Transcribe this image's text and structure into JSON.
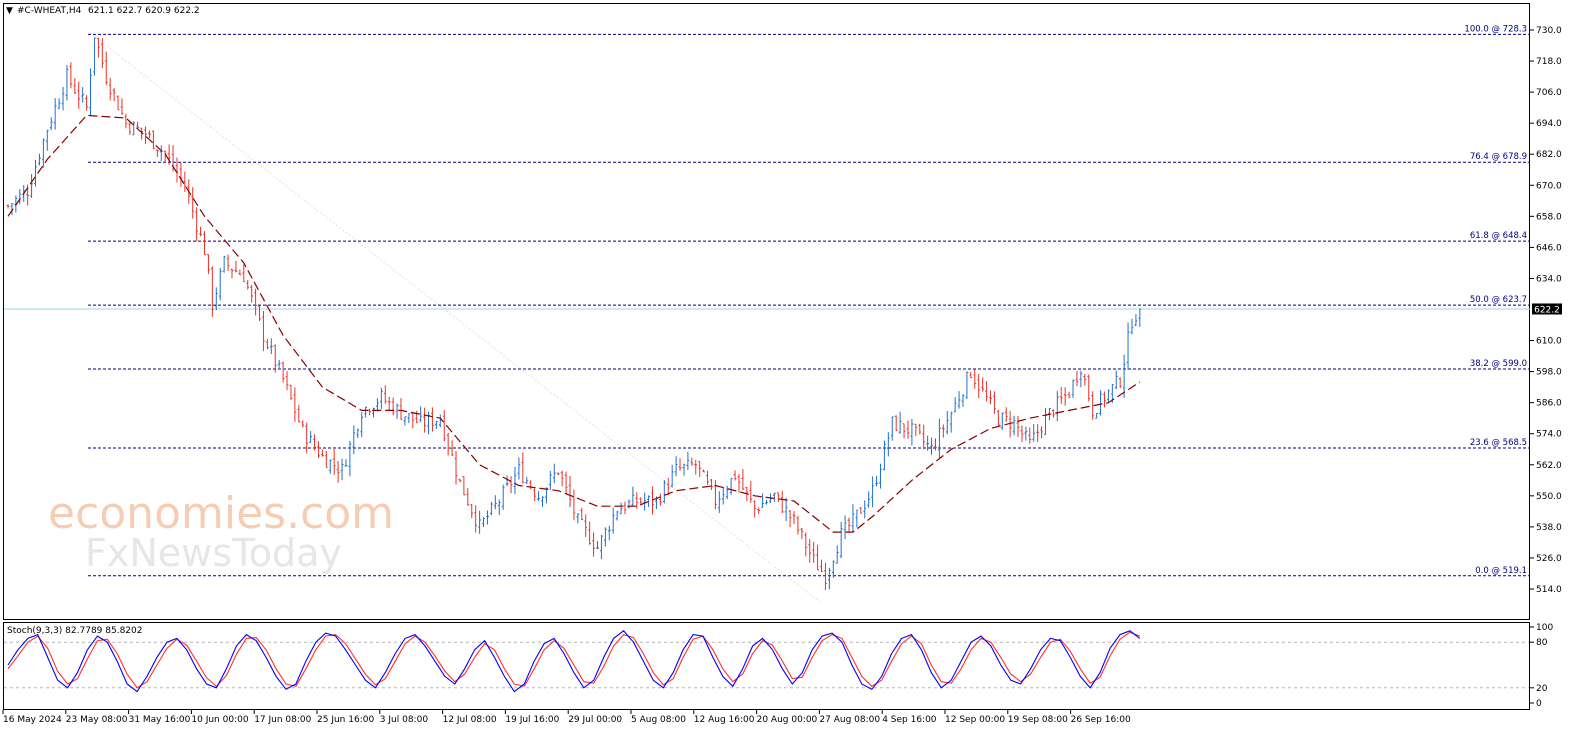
{
  "header": {
    "title_prefix": "▼",
    "title": "#C-WHEAT,H4",
    "ohlc": "621.1 622.7 620.9 622.2"
  },
  "watermark": {
    "line1": "economies.com",
    "line2": "FxNewsToday"
  },
  "colors": {
    "up": "#1f6fd1",
    "down": "#e8322a",
    "ma": "#8b0000",
    "fib": "#00007f",
    "price_line": "#9fd4ea",
    "stoch_main": "#0000ff",
    "stoch_signal": "#ff3030"
  },
  "price_axis": {
    "ticks": [
      "730.0",
      "718.0",
      "706.0",
      "694.0",
      "682.0",
      "670.0",
      "658.0",
      "646.0",
      "634.0",
      "622.2",
      "610.0",
      "598.0",
      "586.0",
      "574.0",
      "562.0",
      "550.0",
      "538.0",
      "526.0",
      "514.0"
    ],
    "current": "622.2"
  },
  "fib_levels": [
    {
      "label": "100.0 @ 728.3",
      "value": 728.3
    },
    {
      "label": "76.4 @ 678.9",
      "value": 678.9
    },
    {
      "label": "61.8 @ 648.4",
      "value": 648.4
    },
    {
      "label": "50.0 @ 623.7",
      "value": 623.7
    },
    {
      "label": "38.2 @ 599.0",
      "value": 599.0
    },
    {
      "label": "23.6 @ 568.5",
      "value": 568.5
    },
    {
      "label": "0.0 @ 519.1",
      "value": 519.1
    }
  ],
  "stoch": {
    "label": "Stoch(9,3,3) 82.7789 85.8202",
    "ticks": [
      "100",
      "80",
      "20",
      "0"
    ],
    "main": 82.78,
    "signal": 85.82
  },
  "time_axis": [
    "16 May 2024",
    "23 May 08:00",
    "31 May 16:00",
    "10 Jun 00:00",
    "17 Jun 08:00",
    "25 Jun 16:00",
    "3 Jul 08:00",
    "12 Jul 08:00",
    "19 Jul 16:00",
    "29 Jul 00:00",
    "5 Aug 08:00",
    "12 Aug 16:00",
    "20 Aug 00:00",
    "27 Aug 08:00",
    "4 Sep 16:00",
    "12 Sep 00:00",
    "19 Sep 08:00",
    "26 Sep 16:00"
  ],
  "chart_data": {
    "type": "candlestick",
    "symbol": "#C-WHEAT",
    "timeframe": "H4",
    "ylim": [
      514,
      732
    ],
    "close_path": [
      {
        "bar": 0,
        "close": 662
      },
      {
        "bar": 5,
        "close": 668
      },
      {
        "bar": 10,
        "close": 692
      },
      {
        "bar": 15,
        "close": 712
      },
      {
        "bar": 20,
        "close": 700
      },
      {
        "bar": 22,
        "close": 728.3
      },
      {
        "bar": 25,
        "close": 712
      },
      {
        "bar": 30,
        "close": 694
      },
      {
        "bar": 35,
        "close": 690
      },
      {
        "bar": 40,
        "close": 682
      },
      {
        "bar": 45,
        "close": 670
      },
      {
        "bar": 50,
        "close": 645
      },
      {
        "bar": 52,
        "close": 624
      },
      {
        "bar": 55,
        "close": 640
      },
      {
        "bar": 60,
        "close": 635
      },
      {
        "bar": 65,
        "close": 612
      },
      {
        "bar": 70,
        "close": 595
      },
      {
        "bar": 75,
        "close": 575
      },
      {
        "bar": 80,
        "close": 565
      },
      {
        "bar": 85,
        "close": 560
      },
      {
        "bar": 90,
        "close": 583
      },
      {
        "bar": 95,
        "close": 588
      },
      {
        "bar": 100,
        "close": 582
      },
      {
        "bar": 105,
        "close": 578
      },
      {
        "bar": 110,
        "close": 580
      },
      {
        "bar": 115,
        "close": 555
      },
      {
        "bar": 120,
        "close": 538
      },
      {
        "bar": 125,
        "close": 548
      },
      {
        "bar": 130,
        "close": 560
      },
      {
        "bar": 135,
        "close": 550
      },
      {
        "bar": 140,
        "close": 560
      },
      {
        "bar": 145,
        "close": 540
      },
      {
        "bar": 150,
        "close": 530
      },
      {
        "bar": 155,
        "close": 545
      },
      {
        "bar": 160,
        "close": 548
      },
      {
        "bar": 165,
        "close": 548
      },
      {
        "bar": 170,
        "close": 560
      },
      {
        "bar": 175,
        "close": 562
      },
      {
        "bar": 180,
        "close": 548
      },
      {
        "bar": 185,
        "close": 558
      },
      {
        "bar": 190,
        "close": 545
      },
      {
        "bar": 195,
        "close": 550
      },
      {
        "bar": 200,
        "close": 540
      },
      {
        "bar": 205,
        "close": 525
      },
      {
        "bar": 208,
        "close": 519.1
      },
      {
        "bar": 212,
        "close": 535
      },
      {
        "bar": 215,
        "close": 540
      },
      {
        "bar": 220,
        "close": 552
      },
      {
        "bar": 225,
        "close": 578
      },
      {
        "bar": 230,
        "close": 575
      },
      {
        "bar": 235,
        "close": 568
      },
      {
        "bar": 240,
        "close": 582
      },
      {
        "bar": 245,
        "close": 598
      },
      {
        "bar": 248,
        "close": 590
      },
      {
        "bar": 252,
        "close": 580
      },
      {
        "bar": 256,
        "close": 578
      },
      {
        "bar": 260,
        "close": 570
      },
      {
        "bar": 265,
        "close": 582
      },
      {
        "bar": 270,
        "close": 590
      },
      {
        "bar": 273,
        "close": 600
      },
      {
        "bar": 276,
        "close": 583
      },
      {
        "bar": 280,
        "close": 590
      },
      {
        "bar": 283,
        "close": 595
      },
      {
        "bar": 286,
        "close": 618
      },
      {
        "bar": 288,
        "close": 622.2
      }
    ],
    "moving_average": [
      {
        "bar": 0,
        "value": 658
      },
      {
        "bar": 10,
        "value": 680
      },
      {
        "bar": 20,
        "value": 697
      },
      {
        "bar": 30,
        "value": 696
      },
      {
        "bar": 40,
        "value": 682
      },
      {
        "bar": 50,
        "value": 658
      },
      {
        "bar": 60,
        "value": 640
      },
      {
        "bar": 70,
        "value": 612
      },
      {
        "bar": 80,
        "value": 592
      },
      {
        "bar": 90,
        "value": 583
      },
      {
        "bar": 100,
        "value": 583
      },
      {
        "bar": 110,
        "value": 580
      },
      {
        "bar": 120,
        "value": 562
      },
      {
        "bar": 130,
        "value": 554
      },
      {
        "bar": 140,
        "value": 552
      },
      {
        "bar": 150,
        "value": 546
      },
      {
        "bar": 160,
        "value": 546
      },
      {
        "bar": 170,
        "value": 552
      },
      {
        "bar": 180,
        "value": 554
      },
      {
        "bar": 190,
        "value": 550
      },
      {
        "bar": 200,
        "value": 548
      },
      {
        "bar": 210,
        "value": 536
      },
      {
        "bar": 215,
        "value": 536
      },
      {
        "bar": 220,
        "value": 542
      },
      {
        "bar": 230,
        "value": 556
      },
      {
        "bar": 240,
        "value": 568
      },
      {
        "bar": 250,
        "value": 576
      },
      {
        "bar": 260,
        "value": 580
      },
      {
        "bar": 270,
        "value": 583
      },
      {
        "bar": 280,
        "value": 586
      },
      {
        "bar": 288,
        "value": 594
      }
    ],
    "stochastic": {
      "main": [
        50,
        70,
        85,
        90,
        60,
        30,
        20,
        40,
        70,
        88,
        80,
        55,
        25,
        15,
        35,
        60,
        80,
        85,
        70,
        45,
        25,
        20,
        45,
        75,
        90,
        82,
        60,
        35,
        18,
        25,
        55,
        80,
        92,
        88,
        70,
        50,
        30,
        20,
        40,
        65,
        85,
        90,
        75,
        55,
        35,
        25,
        45,
        70,
        82,
        60,
        35,
        15,
        25,
        55,
        78,
        85,
        65,
        40,
        20,
        30,
        60,
        85,
        95,
        80,
        55,
        30,
        20,
        40,
        70,
        90,
        88,
        60,
        35,
        22,
        45,
        75,
        85,
        70,
        45,
        25,
        40,
        70,
        88,
        92,
        80,
        50,
        25,
        18,
        35,
        65,
        85,
        90,
        70,
        40,
        20,
        30,
        55,
        80,
        88,
        75,
        50,
        30,
        25,
        45,
        70,
        85,
        82,
        60,
        35,
        20,
        40,
        72,
        90,
        95,
        85
      ],
      "signal": [
        45,
        62,
        80,
        88,
        72,
        42,
        25,
        32,
        58,
        82,
        84,
        65,
        38,
        20,
        28,
        50,
        72,
        84,
        76,
        55,
        33,
        22,
        36,
        64,
        85,
        86,
        70,
        45,
        25,
        22,
        45,
        70,
        88,
        90,
        78,
        58,
        38,
        24,
        32,
        55,
        78,
        88,
        80,
        62,
        42,
        28,
        38,
        60,
        78,
        70,
        45,
        25,
        22,
        45,
        70,
        82,
        72,
        50,
        28,
        26,
        48,
        75,
        90,
        86,
        65,
        40,
        24,
        32,
        60,
        84,
        88,
        70,
        45,
        28,
        38,
        65,
        82,
        76,
        55,
        32,
        34,
        60,
        82,
        90,
        85,
        60,
        35,
        22,
        30,
        55,
        78,
        88,
        78,
        50,
        28,
        26,
        45,
        70,
        85,
        80,
        60,
        38,
        28,
        38,
        60,
        80,
        84,
        68,
        45,
        26,
        34,
        62,
        84,
        93,
        88
      ],
      "ylim": [
        0,
        100
      ],
      "levels": [
        20,
        80
      ]
    }
  }
}
